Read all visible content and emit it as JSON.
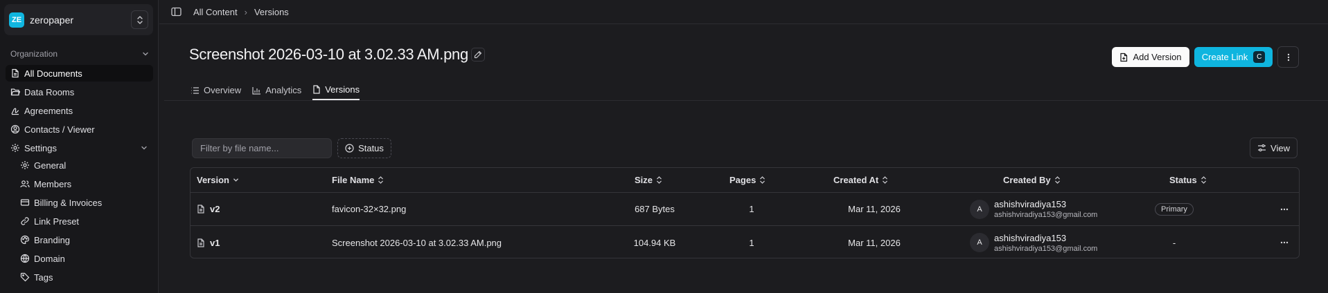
{
  "workspace": {
    "logo": "ZE",
    "name": "zeropaper"
  },
  "sidebar": {
    "org_label": "Organization",
    "items": [
      {
        "label": "All Documents",
        "icon": "document-icon"
      },
      {
        "label": "Data Rooms",
        "icon": "folder-open-icon"
      },
      {
        "label": "Agreements",
        "icon": "signature-icon"
      },
      {
        "label": "Contacts / Viewer",
        "icon": "user-circle-icon"
      },
      {
        "label": "Settings",
        "icon": "gear-icon"
      }
    ],
    "settings_items": [
      {
        "label": "General",
        "icon": "gear-icon"
      },
      {
        "label": "Members",
        "icon": "users-icon"
      },
      {
        "label": "Billing & Invoices",
        "icon": "credit-card-icon"
      },
      {
        "label": "Link Preset",
        "icon": "link-icon"
      },
      {
        "label": "Branding",
        "icon": "palette-icon"
      },
      {
        "label": "Domain",
        "icon": "globe-icon"
      },
      {
        "label": "Tags",
        "icon": "tag-icon"
      }
    ]
  },
  "breadcrumb": {
    "root": "All Content",
    "current": "Versions"
  },
  "document": {
    "title": "Screenshot 2026-03-10 at 3.02.33 AM.png"
  },
  "actions": {
    "add_version": "Add Version",
    "create_link": "Create Link",
    "create_link_shortcut": "C"
  },
  "tabs": [
    {
      "label": "Overview",
      "icon": "list-icon"
    },
    {
      "label": "Analytics",
      "icon": "bar-chart-icon"
    },
    {
      "label": "Versions",
      "icon": "document-icon"
    }
  ],
  "filters": {
    "placeholder": "Filter by file name...",
    "status_label": "Status",
    "view_label": "View"
  },
  "table": {
    "columns": [
      "Version",
      "File Name",
      "Size",
      "Pages",
      "Created At",
      "Created By",
      "Status"
    ],
    "rows": [
      {
        "version": "v2",
        "file_name": "favicon-32×32.png",
        "size": "687 Bytes",
        "pages": "1",
        "created_at": "Mar 11, 2026",
        "avatar": "A",
        "created_by": "ashishviradiya153",
        "email": "ashishviradiya153@gmail.com",
        "status": "Primary"
      },
      {
        "version": "v1",
        "file_name": "Screenshot 2026-03-10 at 3.02.33 AM.png",
        "size": "104.94 KB",
        "pages": "1",
        "created_at": "Mar 11, 2026",
        "avatar": "A",
        "created_by": "ashishviradiya153",
        "email": "ashishviradiya153@gmail.com",
        "status": "-"
      }
    ]
  }
}
